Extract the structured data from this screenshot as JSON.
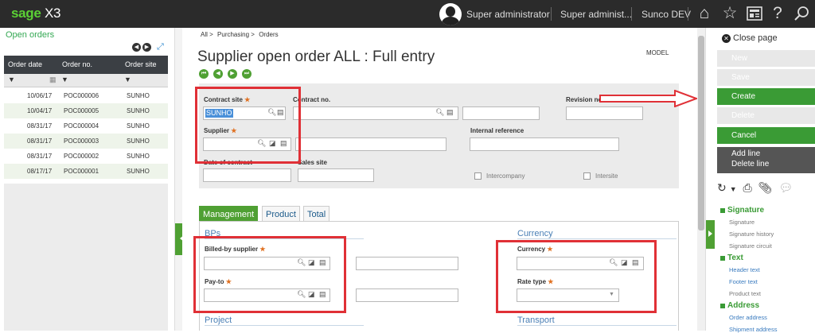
{
  "header": {
    "logo_sage": "sage",
    "logo_x3": "X3",
    "user": "Super administrator",
    "role": "Super administ...",
    "folder": "Sunco DEV",
    "icons": [
      "home-icon",
      "star-icon",
      "news-icon",
      "help-icon",
      "search-icon"
    ]
  },
  "left": {
    "title": "Open orders",
    "columns": [
      "Order date",
      "Order no.",
      "Order site"
    ],
    "rows": [
      {
        "date": "10/06/17",
        "no": "POC000006",
        "site": "SUNHO"
      },
      {
        "date": "10/04/17",
        "no": "POC000005",
        "site": "SUNHO"
      },
      {
        "date": "08/31/17",
        "no": "POC000004",
        "site": "SUNHO"
      },
      {
        "date": "08/31/17",
        "no": "POC000003",
        "site": "SUNHO"
      },
      {
        "date": "08/31/17",
        "no": "POC000002",
        "site": "SUNHO"
      },
      {
        "date": "08/17/17",
        "no": "POC000001",
        "site": "SUNHO"
      }
    ]
  },
  "main": {
    "breadcrumb": [
      "All >",
      "Purchasing >",
      "Orders"
    ],
    "title": "Supplier open order ALL : Full entry",
    "model": "MODEL",
    "fields": {
      "contract_site_label": "Contract site",
      "contract_site_value": "SUNHO",
      "contract_no_label": "Contract no.",
      "revision_label": "Revision no.",
      "supplier_label": "Supplier",
      "internal_ref_label": "Internal reference",
      "date_label": "Date of contract",
      "sales_site_label": "Sales site",
      "intercompany_label": "Intercompany",
      "intersite_label": "Intersite"
    },
    "tabs": [
      "Management",
      "Product",
      "Total"
    ],
    "sections": {
      "bps": "BPs",
      "currency": "Currency",
      "project": "Project",
      "transport": "Transport"
    },
    "lower": {
      "billed_label": "Billed-by supplier",
      "payto_label": "Pay-to",
      "currency_label": "Currency",
      "rate_label": "Rate type"
    },
    "required": "★"
  },
  "right": {
    "close": "Close page",
    "buttons": {
      "new": "New",
      "save": "Save",
      "create": "Create",
      "delete": "Delete",
      "cancel": "Cancel",
      "add_line": "Add line",
      "delete_line": "Delete line"
    },
    "groups": [
      {
        "title": "Signature",
        "items": [
          "Signature",
          "Signature history",
          "Signature circuit"
        ]
      },
      {
        "title": "Text",
        "items": [
          "Header text",
          "Footer text",
          "Product text"
        ]
      },
      {
        "title": "Address",
        "items": [
          "Order address",
          "Shipment address"
        ]
      }
    ]
  }
}
